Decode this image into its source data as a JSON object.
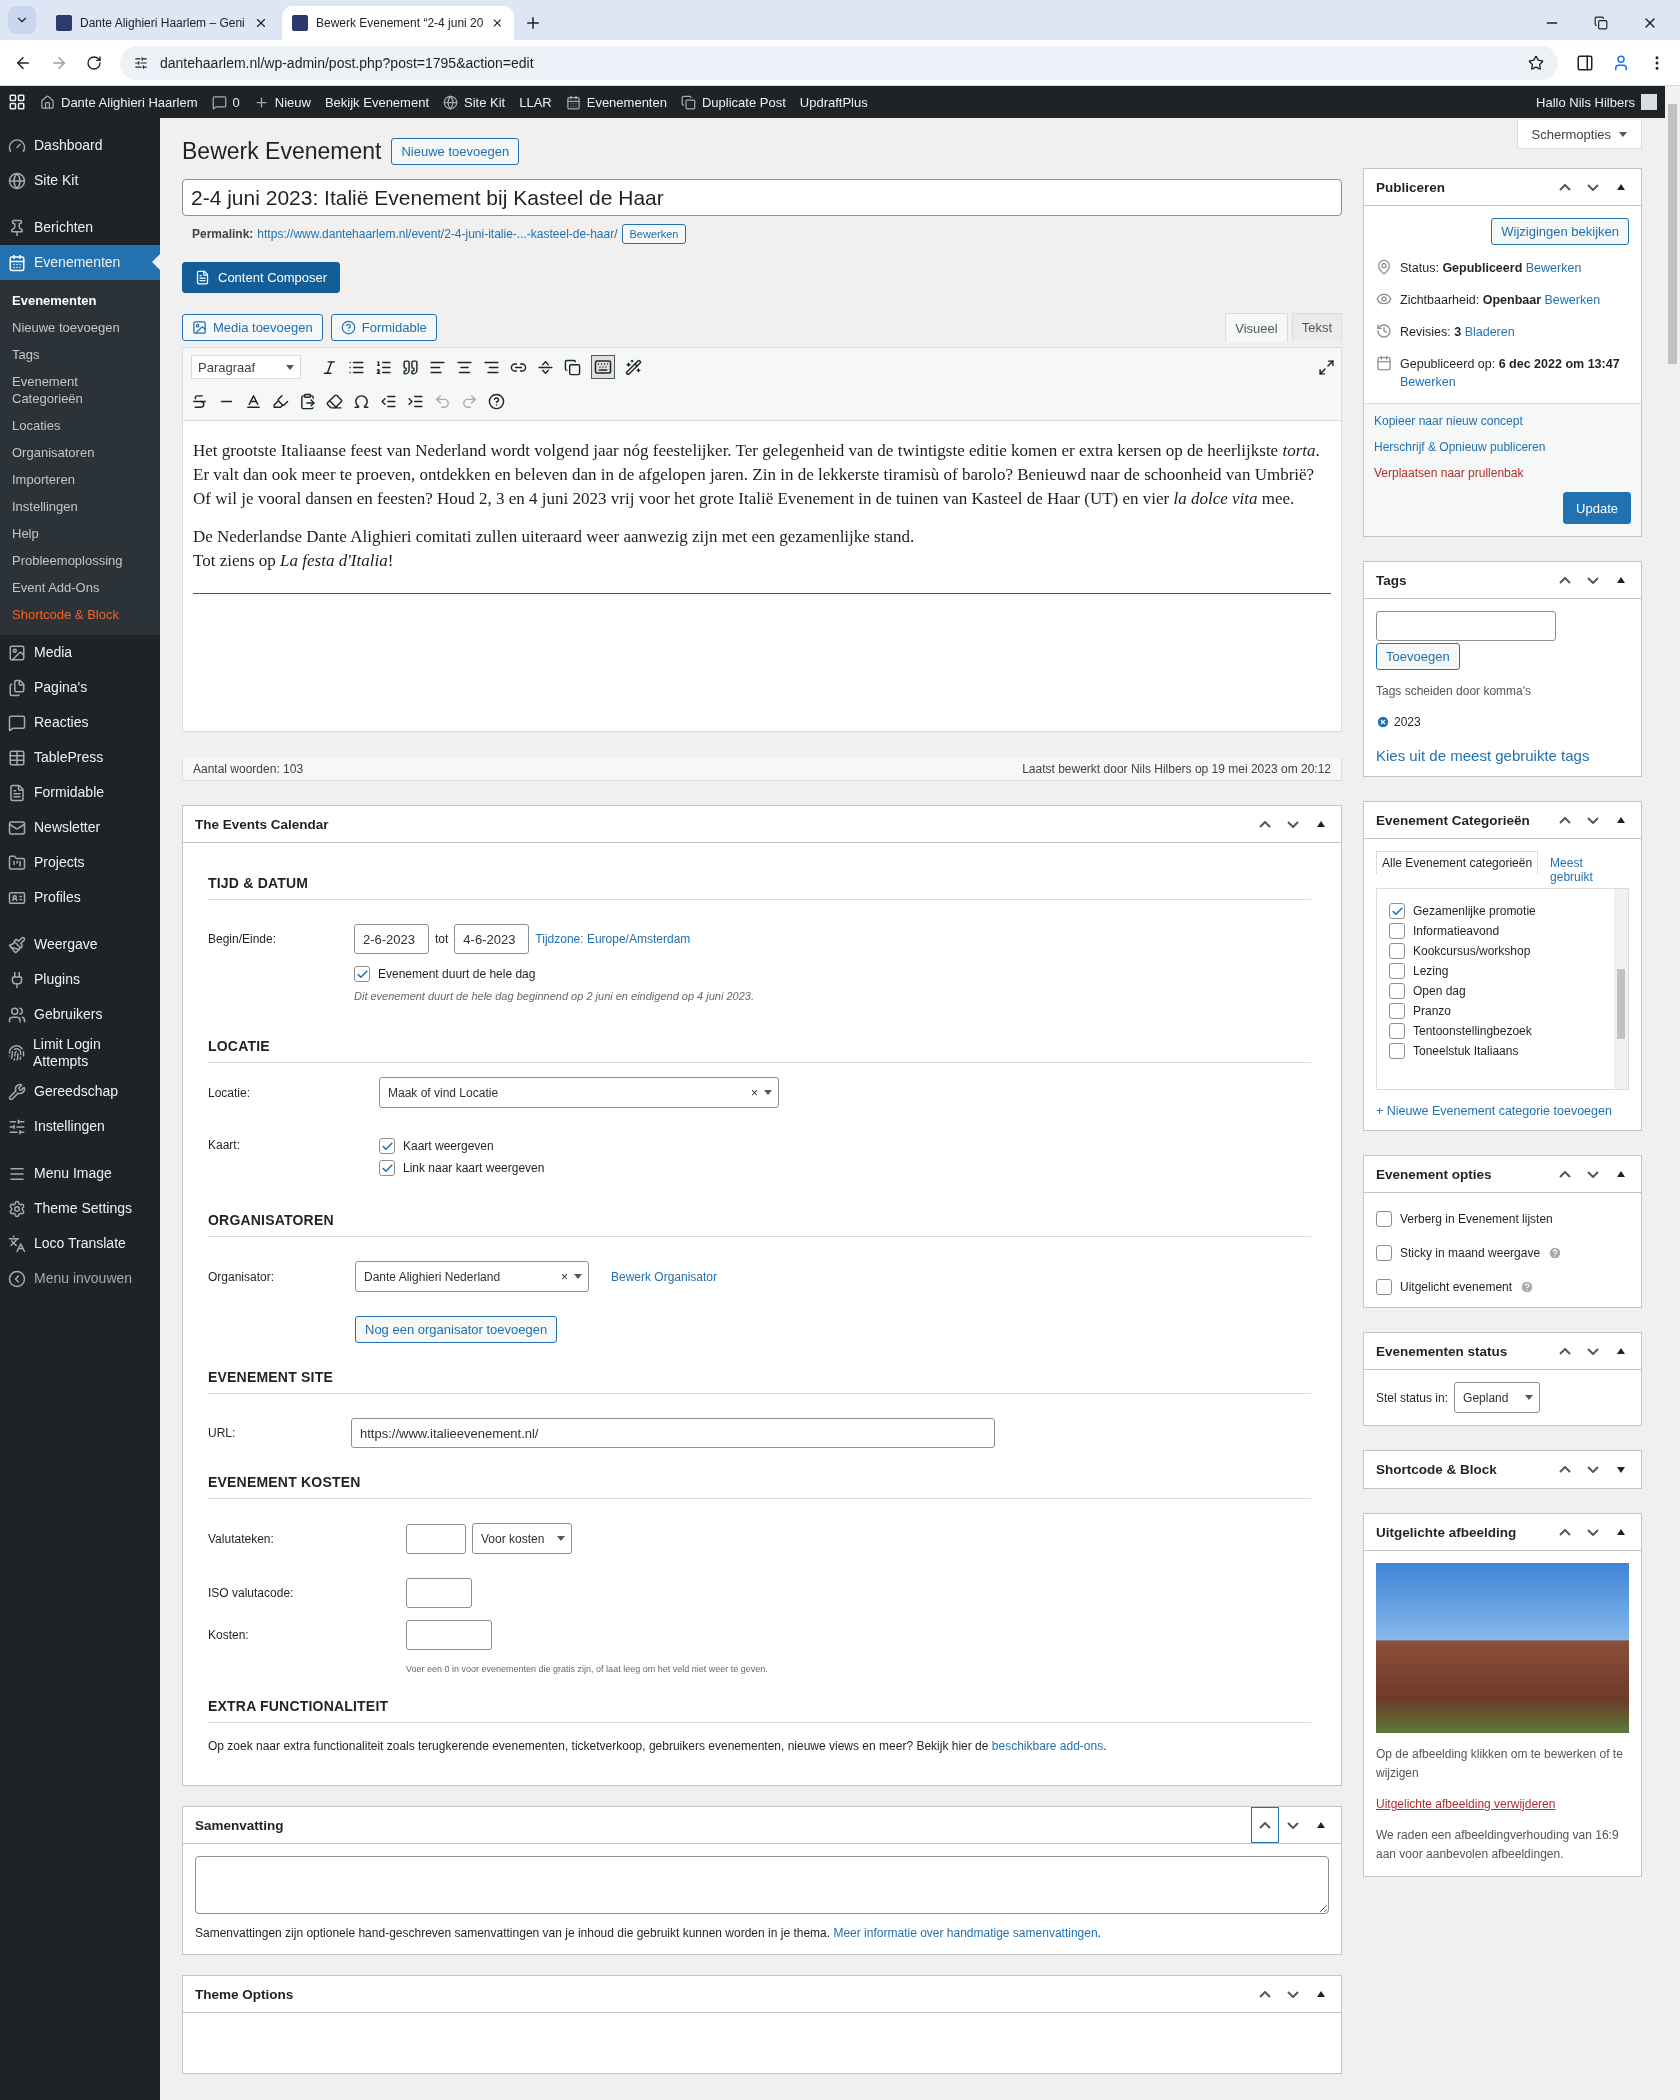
{
  "browser": {
    "tabs": [
      {
        "title": "Dante Alighieri Haarlem – Geni",
        "selected": false
      },
      {
        "title": "Bewerk Evenement “2-4 juni 20",
        "selected": true
      }
    ],
    "url": "dantehaarlem.nl/wp-admin/post.php?post=1795&action=edit"
  },
  "admin_bar": {
    "items": [
      {
        "label": "Dante Alighieri Haarlem"
      },
      {
        "label": "0"
      },
      {
        "label": "Nieuw"
      },
      {
        "label": "Bekijk Evenement"
      },
      {
        "label": "Site Kit"
      },
      {
        "label": "LLAR"
      },
      {
        "label": "Evenementen"
      },
      {
        "label": "Duplicate Post"
      },
      {
        "label": "UpdraftPlus"
      }
    ],
    "greeting": "Hallo Nils Hilbers"
  },
  "sidebar": {
    "groups": [
      [
        {
          "label": "Dashboard",
          "selected": false,
          "kind": "normal"
        },
        {
          "label": "Site Kit",
          "selected": false,
          "kind": "normal"
        }
      ],
      [
        {
          "label": "Berichten",
          "selected": false,
          "kind": "normal"
        },
        {
          "label": "Evenementen",
          "selected": true,
          "kind": "normal",
          "children": [
            {
              "label": "Evenementen",
              "selected": true,
              "kind": "normal"
            },
            {
              "label": "Nieuwe toevoegen",
              "selected": false,
              "kind": "normal"
            },
            {
              "label": "Tags",
              "selected": false,
              "kind": "normal"
            },
            {
              "label": "Evenement Categorieën",
              "selected": false,
              "kind": "normal"
            },
            {
              "label": "Locaties",
              "selected": false,
              "kind": "normal"
            },
            {
              "label": "Organisatoren",
              "selected": false,
              "kind": "normal"
            },
            {
              "label": "Importeren",
              "selected": false,
              "kind": "normal"
            },
            {
              "label": "Instellingen",
              "selected": false,
              "kind": "normal"
            },
            {
              "label": "Help",
              "selected": false,
              "kind": "normal"
            },
            {
              "label": "Probleemoplossing",
              "selected": false,
              "kind": "normal"
            },
            {
              "label": "Event Add-Ons",
              "selected": false,
              "kind": "normal"
            },
            {
              "label": "Shortcode & Block",
              "selected": false,
              "kind": "highlight"
            }
          ]
        },
        {
          "label": "Media",
          "selected": false,
          "kind": "normal"
        },
        {
          "label": "Pagina's",
          "selected": false,
          "kind": "normal"
        },
        {
          "label": "Reacties",
          "selected": false,
          "kind": "normal"
        },
        {
          "label": "TablePress",
          "selected": false,
          "kind": "normal"
        },
        {
          "label": "Formidable",
          "selected": false,
          "kind": "normal"
        },
        {
          "label": "Newsletter",
          "selected": false,
          "kind": "normal"
        },
        {
          "label": "Projects",
          "selected": false,
          "kind": "normal"
        },
        {
          "label": "Profiles",
          "selected": false,
          "kind": "normal"
        }
      ],
      [
        {
          "label": "Weergave",
          "selected": false,
          "kind": "normal"
        },
        {
          "label": "Plugins",
          "selected": false,
          "kind": "normal"
        },
        {
          "label": "Gebruikers",
          "selected": false,
          "kind": "normal"
        },
        {
          "label": "Limit Login Attempts",
          "selected": false,
          "kind": "normal"
        },
        {
          "label": "Gereedschap",
          "selected": false,
          "kind": "normal"
        },
        {
          "label": "Instellingen",
          "selected": false,
          "kind": "normal"
        }
      ],
      [
        {
          "label": "Menu Image",
          "selected": false,
          "kind": "normal"
        },
        {
          "label": "Theme Settings",
          "selected": false,
          "kind": "normal"
        },
        {
          "label": "Loco Translate",
          "selected": false,
          "kind": "normal"
        },
        {
          "label": "Menu invouwen",
          "selected": false,
          "kind": "collapse"
        }
      ]
    ]
  },
  "heading": "Bewerk Evenement",
  "add_new": "Nieuwe toevoegen",
  "screen_options": "Schermopties",
  "title_value": "2-4 juni 2023: Italië Evenement bij Kasteel de Haar",
  "permalink": {
    "label": "Permalink:",
    "url": "https://www.dantehaarlem.nl/event/2-4-juni-italie-...-kasteel-de-haar/",
    "button": "Bewerken"
  },
  "content_composer": "Content Composer",
  "media_buttons": [
    "Media toevoegen",
    "Formidable"
  ],
  "editor_tabs": [
    {
      "label": "Visueel",
      "selected": true
    },
    {
      "label": "Tekst",
      "selected": false
    }
  ],
  "format_select": "Paragraaf",
  "toolbar_toggle_on": true,
  "paragraphs": [
    {
      "lines": [
        "Het grootste Italiaanse feest van Nederland wordt volgend jaar nóg feestelijker. Ter gelegenheid van de twintigste editie komen er extra kersen op de heerlijkste *torta*. Er valt dan ook meer te proeven, ontdekken en beleven dan in de afgelopen jaren. Zin in de lekkerste tiramisù of barolo? Benieuwd naar de schoonheid van Umbrië? Of wil je vooral dansen en feesten? Houd 2, 3 en 4 juni 2023 vrij voor het grote Italië Evenement in de tuinen van Kasteel de Haar (UT) en vier *la dolce vita* mee."
      ]
    },
    {
      "lines": [
        "De Nederlandse Dante Alighieri comitati zullen uiteraard weer aanwezig zijn met een gezamenlijke stand.",
        "Tot ziens op *La festa d'Italia*!"
      ]
    }
  ],
  "editor_status": {
    "word_count": "Aantal woorden: 103",
    "last_edited": "Laatst bewerkt door Nils Hilbers op 19 mei 2023 om 20:12"
  },
  "events_calendar": {
    "title": "The Events Calendar",
    "collapsed": false,
    "time_date": {
      "heading": "TIJD & DATUM",
      "label": "Begin/Einde:",
      "start": "2-6-2023",
      "separator": "tot",
      "end": "4-6-2023",
      "timezone_link": "Tijdzone: Europe/Amsterdam",
      "all_day": {
        "label": "Evenement duurt de hele dag",
        "checked": true
      },
      "note": "Dit evenement duurt de hele dag beginnend op 2 juni en eindigend op 4 juni 2023."
    },
    "location": {
      "heading": "LOCATIE",
      "label": "Locatie:",
      "select": "Maak of vind Locatie",
      "clear": "×",
      "map_label": "Kaart:",
      "options": [
        {
          "label": "Kaart weergeven",
          "checked": true
        },
        {
          "label": "Link naar kaart weergeven",
          "checked": true
        }
      ]
    },
    "organizers": {
      "heading": "ORGANISATOREN",
      "label": "Organisator:",
      "select": "Dante Alighieri Nederland",
      "clear": "×",
      "edit_link": "Bewerk Organisator",
      "add_button": "Nog een organisator toevoegen"
    },
    "site": {
      "heading": "EVENEMENT SITE",
      "label": "URL:",
      "value": "https://www.italieevenement.nl/"
    },
    "costs": {
      "heading": "EVENEMENT KOSTEN",
      "currency_label": "Valutateken:",
      "position_select": "Voor kosten",
      "iso_label": "ISO valutacode:",
      "cost_label": "Kosten:",
      "note": "Voer een 0 in voor evenementen die gratis zijn, of laat leeg om het veld niet weer te geven."
    },
    "extra": {
      "heading": "EXTRA FUNCTIONALITEIT",
      "text": "Op zoek naar extra functionaliteit zoals terugkerende evenementen, ticketverkoop, gebruikers evenementen, nieuwe views en meer? Bekijk hier de",
      "link": "beschikbare add-ons",
      "after": "."
    }
  },
  "excerpt": {
    "title": "Samenvatting",
    "collapsed": false,
    "up_focused": true,
    "note": "Samenvattingen zijn optionele hand-geschreven samenvattingen van je inhoud die gebruikt kunnen worden in je thema.",
    "link": "Meer informatie over handmatige samenvattingen",
    "after": "."
  },
  "theme_options": {
    "title": "Theme Options",
    "collapsed": false
  },
  "publish": {
    "title": "Publiceren",
    "collapsed": false,
    "preview": "Wijzigingen bekijken",
    "rows": [
      {
        "text": "Status: **Gepubliceerd**",
        "link": "Bewerken"
      },
      {
        "text": "Zichtbaarheid: **Openbaar**",
        "link": "Bewerken"
      },
      {
        "text": "Revisies: **3**",
        "link": "Bladeren"
      },
      {
        "text": "Gepubliceerd op: **6 dec 2022 om 13:47**",
        "link": "Bewerken"
      }
    ],
    "actions": [
      {
        "label": "Kopieer naar nieuw concept",
        "kind": "link"
      },
      {
        "label": "Herschrijf & Opnieuw publiceren",
        "kind": "link"
      },
      {
        "label": "Verplaatsen naar prullenbak",
        "kind": "danger"
      }
    ],
    "update": "Update"
  },
  "tags": {
    "title": "Tags",
    "collapsed": false,
    "add": "Toevoegen",
    "hint": "Tags scheiden door komma's",
    "tags": [
      "2023"
    ],
    "choose_link": "Kies uit de meest gebruikte tags"
  },
  "categories": {
    "title": "Evenement Categorieën",
    "collapsed": false,
    "tabs": [
      {
        "label": "Alle Evenement categorieën",
        "selected": true
      },
      {
        "label": "Meest gebruikt",
        "selected": false
      }
    ],
    "items": [
      {
        "label": "Gezamenlijke promotie",
        "checked": true
      },
      {
        "label": "Informatieavond",
        "checked": false
      },
      {
        "label": "Kookcursus/workshop",
        "checked": false
      },
      {
        "label": "Lezing",
        "checked": false
      },
      {
        "label": "Open dag",
        "checked": false
      },
      {
        "label": "Pranzo",
        "checked": false
      },
      {
        "label": "Tentoonstellingbezoek",
        "checked": false
      },
      {
        "label": "Toneelstuk Italiaans",
        "checked": false
      }
    ],
    "add_link": "+ Nieuwe Evenement categorie toevoegen"
  },
  "event_options": {
    "title": "Evenement opties",
    "collapsed": false,
    "items": [
      {
        "label": "Verberg in Evenement lijsten",
        "checked": false,
        "help": false
      },
      {
        "label": "Sticky in maand weergave",
        "checked": false,
        "help": true
      },
      {
        "label": "Uitgelicht evenement",
        "checked": false,
        "help": true
      }
    ]
  },
  "event_status": {
    "title": "Evenementen status",
    "collapsed": false,
    "label": "Stel status in:",
    "select": "Gepland"
  },
  "shortcode": {
    "title": "Shortcode & Block",
    "collapsed": true
  },
  "featured": {
    "title": "Uitgelichte afbeelding",
    "collapsed": false,
    "hint": "Op de afbeelding klikken om te bewerken of te wijzigen",
    "remove": "Uitgelichte afbeelding verwijderen",
    "note": "We raden een afbeeldingverhouding van 16:9 aan voor aanbevolen afbeeldingen."
  }
}
